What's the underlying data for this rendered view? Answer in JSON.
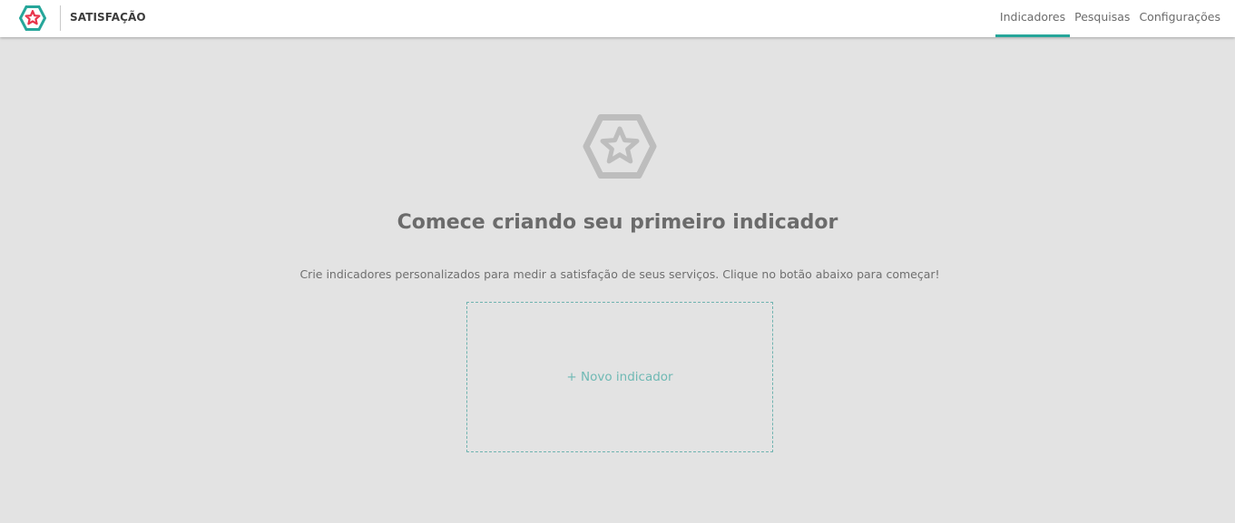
{
  "app": {
    "brand_name": "SATISFAÇÃO",
    "logo_icon": "hexagon-star-logo",
    "colors": {
      "accent": "#26a69a",
      "logo_hexagon": "#26a69a",
      "logo_star": "#e8334a",
      "empty_icon": "#bdbdbd",
      "background": "#e3e3e3"
    }
  },
  "nav": {
    "tabs": [
      {
        "label": "Indicadores",
        "active": true
      },
      {
        "label": "Pesquisas",
        "active": false
      },
      {
        "label": "Configurações",
        "active": false
      }
    ]
  },
  "empty_state": {
    "icon": "hexagon-star-icon",
    "title": "Comece criando seu primeiro indicador",
    "description": "Crie indicadores personalizados para medir a satisfação de seus serviços. Clique no botão abaixo para começar!",
    "new_button_label": "+ Novo indicador"
  }
}
